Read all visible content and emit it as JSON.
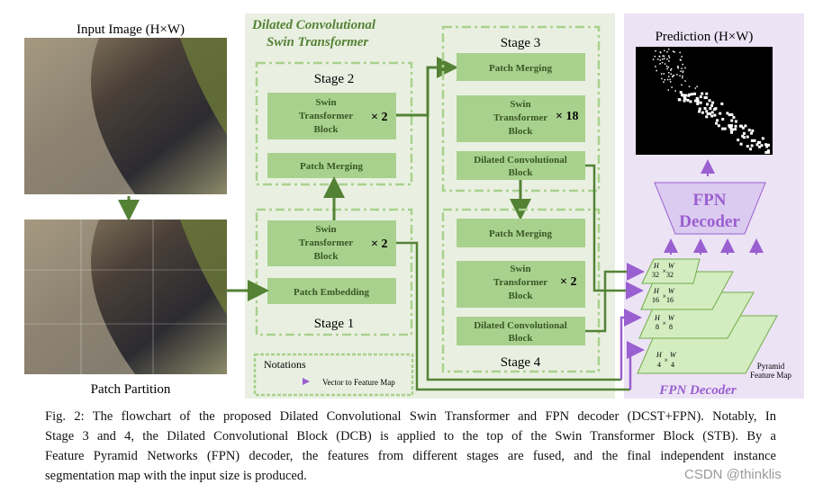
{
  "input_label": "Input Image (H×W)",
  "partition_label": "Patch Partition",
  "dcst_title": [
    "Dilated Convolutional",
    "Swin Transformer"
  ],
  "stage2": {
    "label": "Stage 2",
    "swin": [
      "Swin",
      "Transformer",
      "Block"
    ],
    "mult": "× 2",
    "merge": "Patch Merging"
  },
  "stage1": {
    "label": "Stage 1",
    "swin": [
      "Swin",
      "Transformer",
      "Block"
    ],
    "mult": "× 2",
    "embed": "Patch Embedding"
  },
  "stage3": {
    "label": "Stage 3",
    "merge": "Patch Merging",
    "swin": [
      "Swin",
      "Transformer",
      "Block"
    ],
    "mult": "× 18",
    "dcb": [
      "Dilated Convolutional",
      "Block"
    ]
  },
  "stage4": {
    "label": "Stage 4",
    "merge": "Patch Merging",
    "swin": [
      "Swin",
      "Transformer",
      "Block"
    ],
    "mult": "× 2",
    "dcb": [
      "Dilated Convolutional",
      "Block"
    ]
  },
  "notations": {
    "title": "Notations",
    "item": "Vector to Feature Map"
  },
  "prediction_label": "Prediction (H×W)",
  "fpn_block": [
    "FPN",
    "Decoder"
  ],
  "pyramid": {
    "levels": [
      {
        "h": "H",
        "hd": "32",
        "w": "W",
        "wd": "32"
      },
      {
        "h": "H",
        "hd": "16",
        "w": "W",
        "wd": "16"
      },
      {
        "h": "H",
        "hd": "8",
        "w": "W",
        "wd": "8"
      },
      {
        "h": "H",
        "hd": "4",
        "w": "W",
        "wd": "4"
      }
    ],
    "label": [
      "Pyramid",
      "Feature Map"
    ]
  },
  "fpn_panel_title": "FPN Decoder",
  "caption": [
    "Fig. 2: The flowchart of the proposed Dilated Convolutional Swin Transformer and FPN decoder (DCST+FPN). Notably, In",
    "Stage 3 and 4, the Dilated Convolutional Block (DCB) is applied to the top of the Swin Transformer Block (STB). By a",
    "Feature Pyramid Networks (FPN) decoder, the features from different stages are fused, and the final independent instance",
    "segmentation map with the input size is produced."
  ],
  "watermark": "CSDN @thinklis",
  "colors": {
    "green_panel": "#e9f0e1",
    "block": "#a9d18e",
    "dark_green": "#548235",
    "purple_panel": "#ece3f5",
    "purple": "#9a5fd0",
    "map": "#d3ecc0"
  }
}
